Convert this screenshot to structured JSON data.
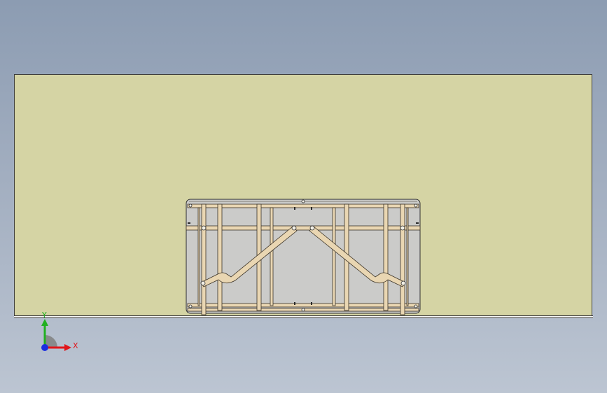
{
  "view": {
    "colors": {
      "background_top": "#8c9cb2",
      "background_bottom": "#bcc5d2",
      "floor": "#d5d4a4",
      "frame_fill": "#cbcbc9",
      "frame_tube": "#e9d6b2",
      "frame_outline": "#3a3226"
    }
  },
  "triad": {
    "x_label": "X",
    "y_label": "Y",
    "x_color": "#e0161b",
    "y_color": "#20b020",
    "z_color": "#1c2ee0"
  }
}
